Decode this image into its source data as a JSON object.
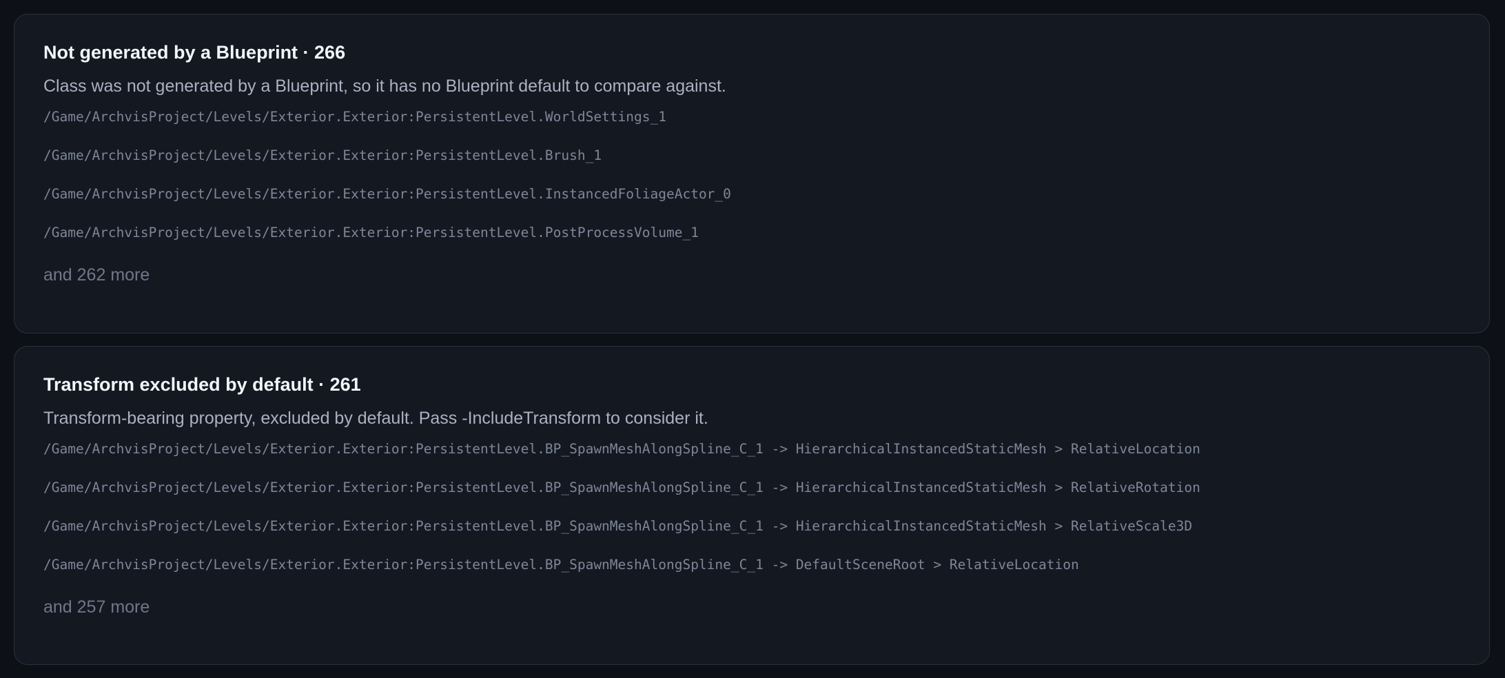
{
  "sections": [
    {
      "title": "Not generated by a Blueprint · 266",
      "description": "Class was not generated by a Blueprint, so it has no Blueprint default to compare against.",
      "paths": [
        "/Game/ArchvisProject/Levels/Exterior.Exterior:PersistentLevel.WorldSettings_1",
        "/Game/ArchvisProject/Levels/Exterior.Exterior:PersistentLevel.Brush_1",
        "/Game/ArchvisProject/Levels/Exterior.Exterior:PersistentLevel.InstancedFoliageActor_0",
        "/Game/ArchvisProject/Levels/Exterior.Exterior:PersistentLevel.PostProcessVolume_1"
      ],
      "more": "and 262 more"
    },
    {
      "title": "Transform excluded by default · 261",
      "description": "Transform-bearing property, excluded by default. Pass -IncludeTransform to consider it.",
      "paths": [
        "/Game/ArchvisProject/Levels/Exterior.Exterior:PersistentLevel.BP_SpawnMeshAlongSpline_C_1 -> HierarchicalInstancedStaticMesh > RelativeLocation",
        "/Game/ArchvisProject/Levels/Exterior.Exterior:PersistentLevel.BP_SpawnMeshAlongSpline_C_1 -> HierarchicalInstancedStaticMesh > RelativeRotation",
        "/Game/ArchvisProject/Levels/Exterior.Exterior:PersistentLevel.BP_SpawnMeshAlongSpline_C_1 -> HierarchicalInstancedStaticMesh > RelativeScale3D",
        "/Game/ArchvisProject/Levels/Exterior.Exterior:PersistentLevel.BP_SpawnMeshAlongSpline_C_1 -> DefaultSceneRoot > RelativeLocation"
      ],
      "more": "and 257 more"
    }
  ],
  "colors": {
    "background": "#0d1017",
    "card": "#141821",
    "card_border": "#2a303c",
    "title": "#f2f5fa",
    "description": "#a9b2c1",
    "path": "#7d8797",
    "more": "#6f7888"
  }
}
